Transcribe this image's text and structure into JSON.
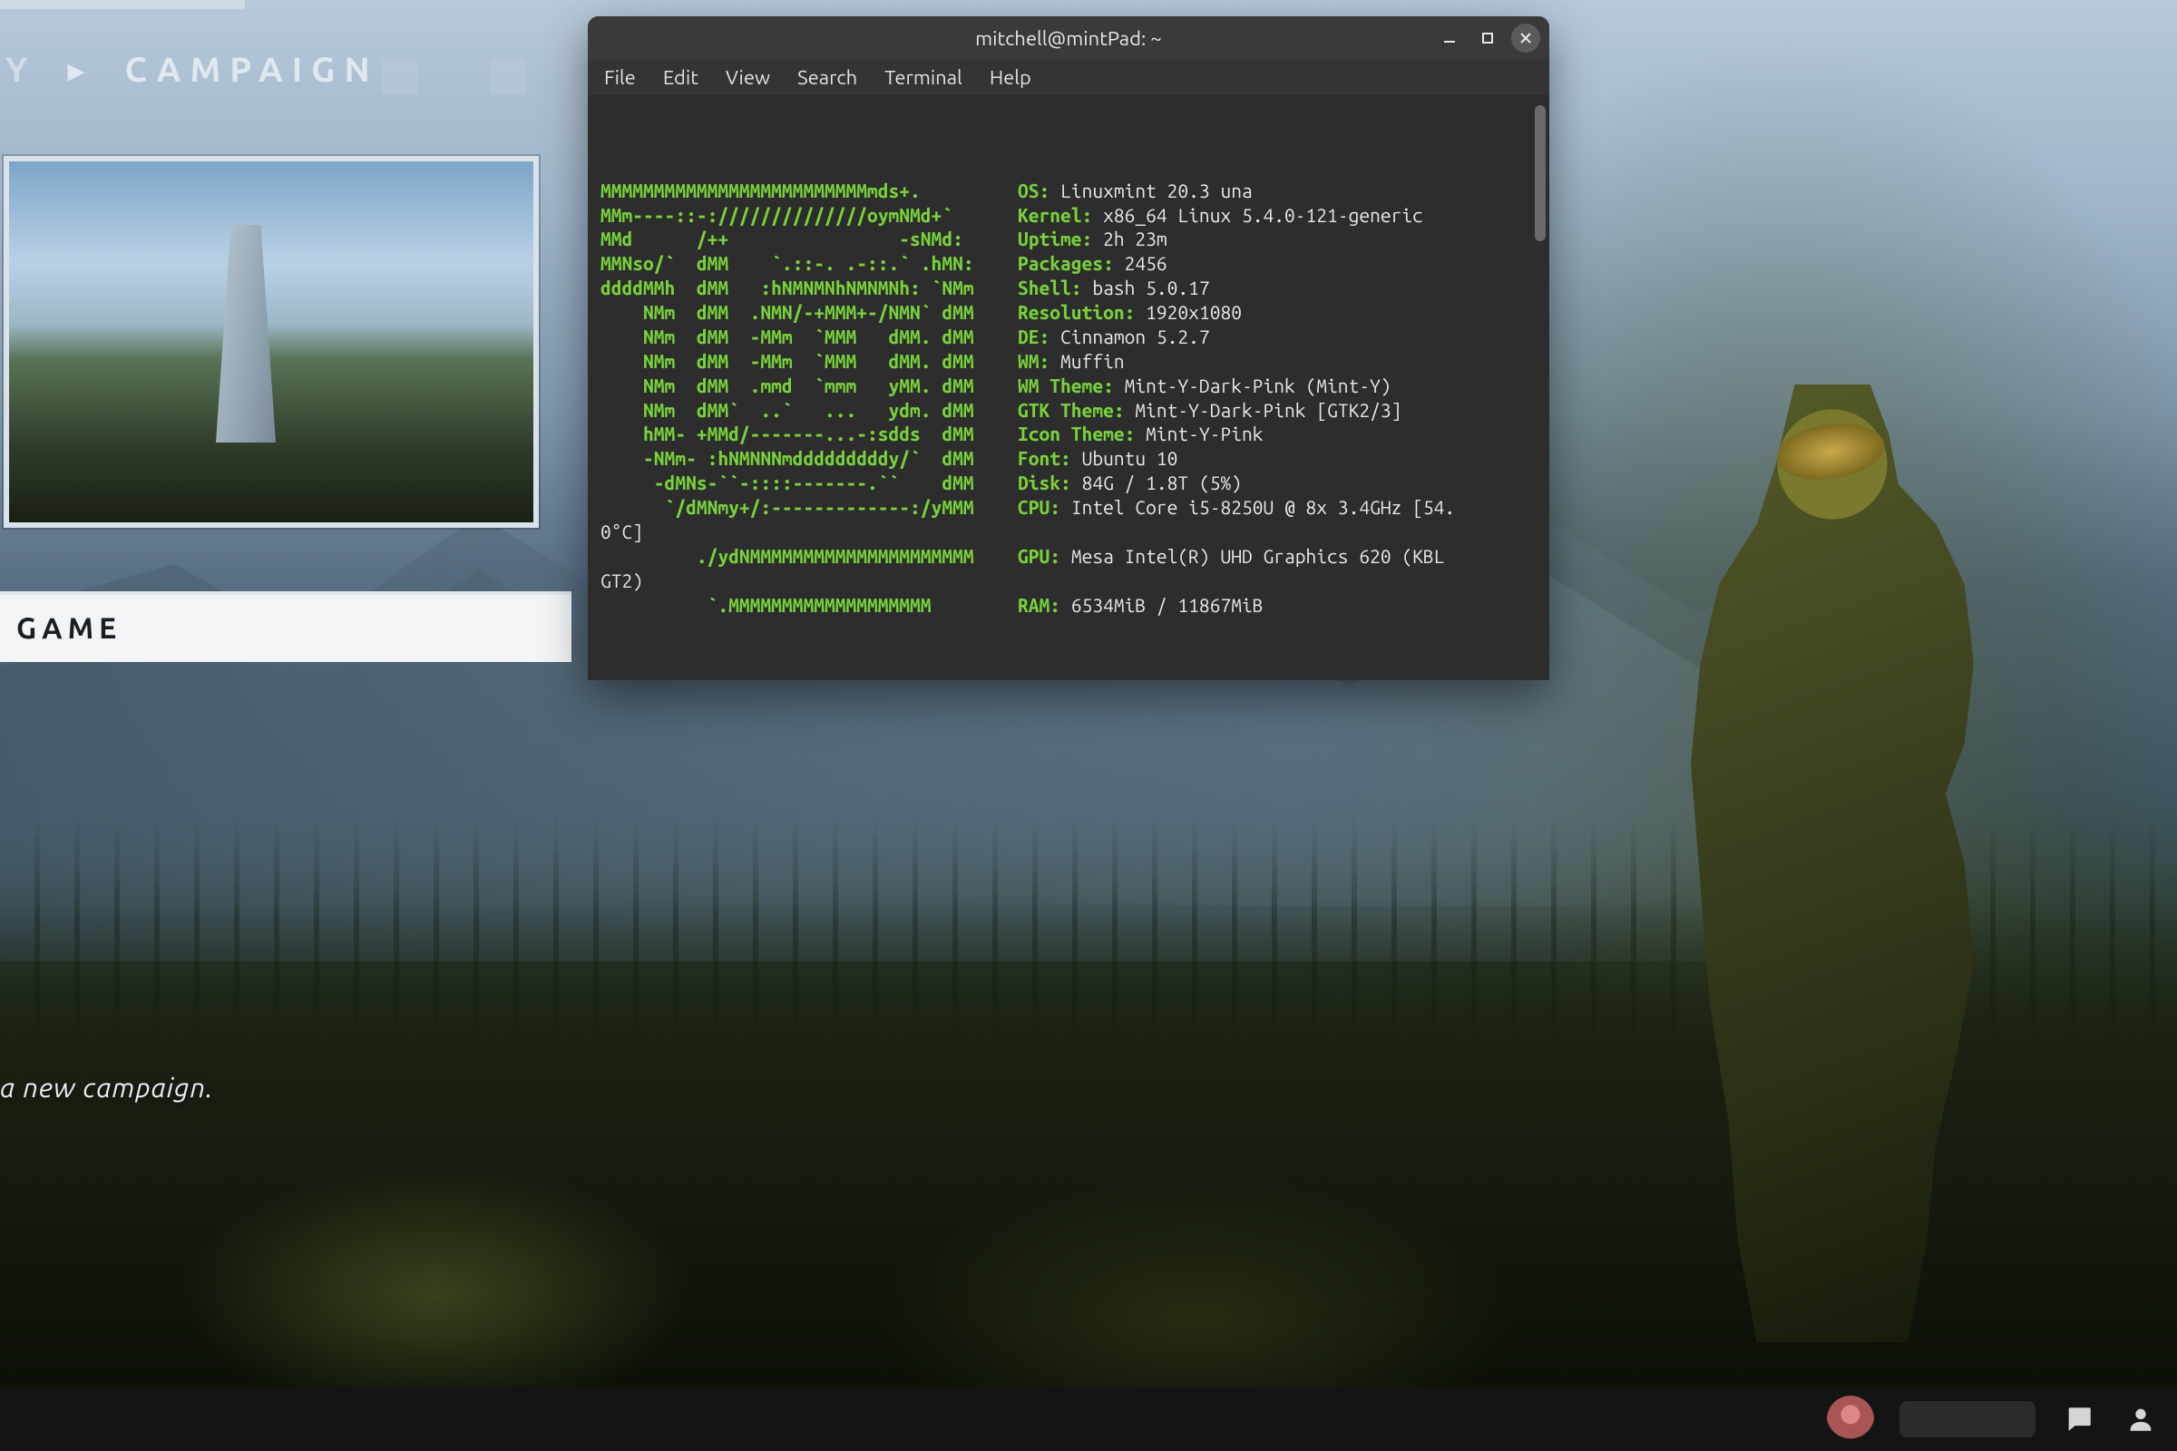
{
  "game": {
    "breadcrumb_glyph": "▸",
    "title": "CAMPAIGN",
    "button_label": "GAME",
    "hint": "a new campaign."
  },
  "terminal": {
    "window_title": "mitchell@mintPad: ~",
    "menus": [
      "File",
      "Edit",
      "View",
      "Search",
      "Terminal",
      "Help"
    ],
    "ascii": [
      "MMMMMMMMMMMMMMMMMMMMMMMMMmds+.",
      "MMm----::-://////////////oymNMd+`",
      "MMd      /++                -sNMd:",
      "MMNso/`  dMM    `.::-. .-::.` .hMN:",
      "ddddMMh  dMM   :hNMNMNhNMNMNh: `NMm",
      "    NMm  dMM  .NMN/-+MMM+-/NMN` dMM",
      "    NMm  dMM  -MMm  `MMM   dMM. dMM",
      "    NMm  dMM  -MMm  `MMM   dMM. dMM",
      "    NMm  dMM  .mmd  `mmm   yMM. dMM",
      "    NMm  dMM`  ..`   ...   ydm. dMM",
      "    hMM- +MMd/-------...-:sdds  dMM",
      "    -NMm- :hNMNNNmdddddddddy/`  dMM",
      "     -dMNs-``-::::-------.``    dMM",
      "      `/dMNmy+/:-------------:/yMMM",
      "",
      "         ./ydNMMMMMMMMMMMMMMMMMMMMM",
      "",
      "          `.MMMMMMMMMMMMMMMMMMM"
    ],
    "info": [
      {
        "label": "OS:",
        "value": "Linuxmint 20.3 una"
      },
      {
        "label": "Kernel:",
        "value": "x86_64 Linux 5.4.0-121-generic"
      },
      {
        "label": "Uptime:",
        "value": "2h 23m"
      },
      {
        "label": "Packages:",
        "value": "2456"
      },
      {
        "label": "Shell:",
        "value": "bash 5.0.17"
      },
      {
        "label": "Resolution:",
        "value": "1920x1080"
      },
      {
        "label": "DE:",
        "value": "Cinnamon 5.2.7"
      },
      {
        "label": "WM:",
        "value": "Muffin"
      },
      {
        "label": "WM Theme:",
        "value": "Mint-Y-Dark-Pink (Mint-Y)"
      },
      {
        "label": "GTK Theme:",
        "value": "Mint-Y-Dark-Pink [GTK2/3]"
      },
      {
        "label": "Icon Theme:",
        "value": "Mint-Y-Pink"
      },
      {
        "label": "Font:",
        "value": "Ubuntu 10"
      },
      {
        "label": "Disk:",
        "value": "84G / 1.8T (5%)"
      },
      {
        "label": "CPU:",
        "value": "Intel Core i5-8250U @ 8x 3.4GHz [54."
      },
      {
        "label": "",
        "value": "0°C]",
        "wrap_left": true
      },
      {
        "label": "GPU:",
        "value": "Mesa Intel(R) UHD Graphics 620 (KBL"
      },
      {
        "label": "",
        "value": "GT2)",
        "wrap_left": true
      },
      {
        "label": "RAM:",
        "value": "6534MiB / 11867MiB"
      }
    ]
  },
  "taskbar": {
    "items": [
      "avatar",
      "username-blob",
      "chat-icon",
      "person-icon"
    ]
  }
}
